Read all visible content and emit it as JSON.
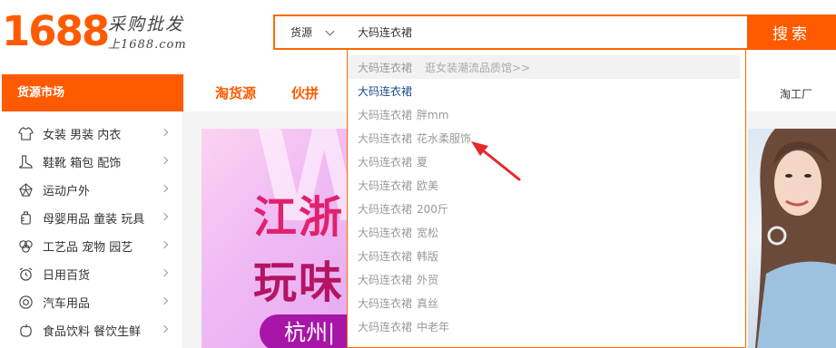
{
  "logo": {
    "number": "1688",
    "slogan": "采购批发",
    "domain": "上1688.com"
  },
  "search": {
    "type_label": "货源",
    "query": "大码连衣裙",
    "button_label": "搜索"
  },
  "categories": {
    "header": "货源市场",
    "items": [
      {
        "label": "女装 男装 内衣",
        "icon": "shirt-icon"
      },
      {
        "label": "鞋靴 箱包 配饰",
        "icon": "boot-icon"
      },
      {
        "label": "运动户外",
        "icon": "sport-icon"
      },
      {
        "label": "母婴用品 童装 玩具",
        "icon": "baby-bottle-icon"
      },
      {
        "label": "工艺品 宠物 园艺",
        "icon": "craft-icon"
      },
      {
        "label": "日用百货",
        "icon": "alarm-clock-icon"
      },
      {
        "label": "汽车用品",
        "icon": "tire-icon"
      },
      {
        "label": "食品饮料 餐饮生鲜",
        "icon": "fruit-icon"
      }
    ]
  },
  "nav": {
    "tabs": [
      "淘货源",
      "伙拼"
    ],
    "right_label": "淘工厂"
  },
  "banner": {
    "line1": "江浙",
    "line2": "玩味",
    "pill": "杭州|",
    "watermark": "W"
  },
  "suggestions": [
    {
      "keyword": "大码连衣裙",
      "suffix": "逛女装潮流品质馆>>"
    },
    {
      "keyword": "大码连衣裙",
      "suffix": ""
    },
    {
      "keyword": "大码连衣裙",
      "suffix": "胖mm"
    },
    {
      "keyword": "大码连衣裙",
      "suffix": "花水柔服饰"
    },
    {
      "keyword": "大码连衣裙",
      "suffix": "夏"
    },
    {
      "keyword": "大码连衣裙",
      "suffix": "欧美"
    },
    {
      "keyword": "大码连衣裙",
      "suffix": "200斤"
    },
    {
      "keyword": "大码连衣裙",
      "suffix": "宽松"
    },
    {
      "keyword": "大码连衣裙",
      "suffix": "韩版"
    },
    {
      "keyword": "大码连衣裙",
      "suffix": "外贸"
    },
    {
      "keyword": "大码连衣裙",
      "suffix": "真丝"
    },
    {
      "keyword": "大码连衣裙",
      "suffix": "中老年"
    }
  ],
  "colors": {
    "brand": "#ff5a00",
    "annotation_arrow": "#e8282b",
    "active_suggestion": "#1a4a8a"
  }
}
